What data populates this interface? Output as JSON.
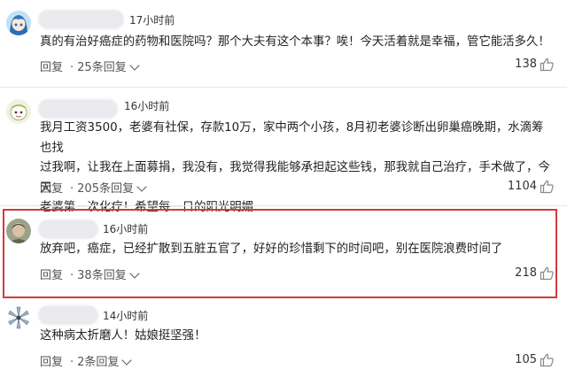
{
  "comments": [
    {
      "time": "17小时前",
      "lines": [
        "真的有治好癌症的药物和医院吗？那个大夫有这个本事？唉！今天活着就是幸福，管它能活多久！"
      ],
      "reply_label": "回复",
      "reply_count": "25条回复",
      "likes": "138",
      "avatar_icon": "anime-girl-avatar"
    },
    {
      "time": "16小时前",
      "lines": [
        "我月工资3500，老婆有社保，存款10万，家中两个小孩，8月初老婆诊断出卵巢癌晚期，水滴筹也找",
        "过我啊，让我在上面募捐，我没有，我觉得我能够承担起这些钱，那我就自己治疗，手术做了，今天",
        "老婆第一次化疗！希望每一日的阳光明媚"
      ],
      "reply_label": "回复",
      "reply_count": "205条回复",
      "likes": "1104",
      "avatar_icon": "cartoon-avatar"
    },
    {
      "time": "16小时前",
      "lines": [
        "放弃吧，癌症，已经扩散到五脏五官了，好好的珍惜剩下的时间吧，别在医院浪费时间了"
      ],
      "reply_label": "回复",
      "reply_count": "38条回复",
      "likes": "218",
      "avatar_icon": "photo-avatar"
    },
    {
      "time": "14小时前",
      "lines": [
        "这种病太折磨人！姑娘挺坚强！"
      ],
      "reply_label": "回复",
      "reply_count": "2条回复",
      "likes": "105",
      "avatar_icon": "flower-avatar"
    }
  ],
  "colors": {
    "highlight": "#d23b3b",
    "text": "#222222",
    "muted": "#555555"
  }
}
